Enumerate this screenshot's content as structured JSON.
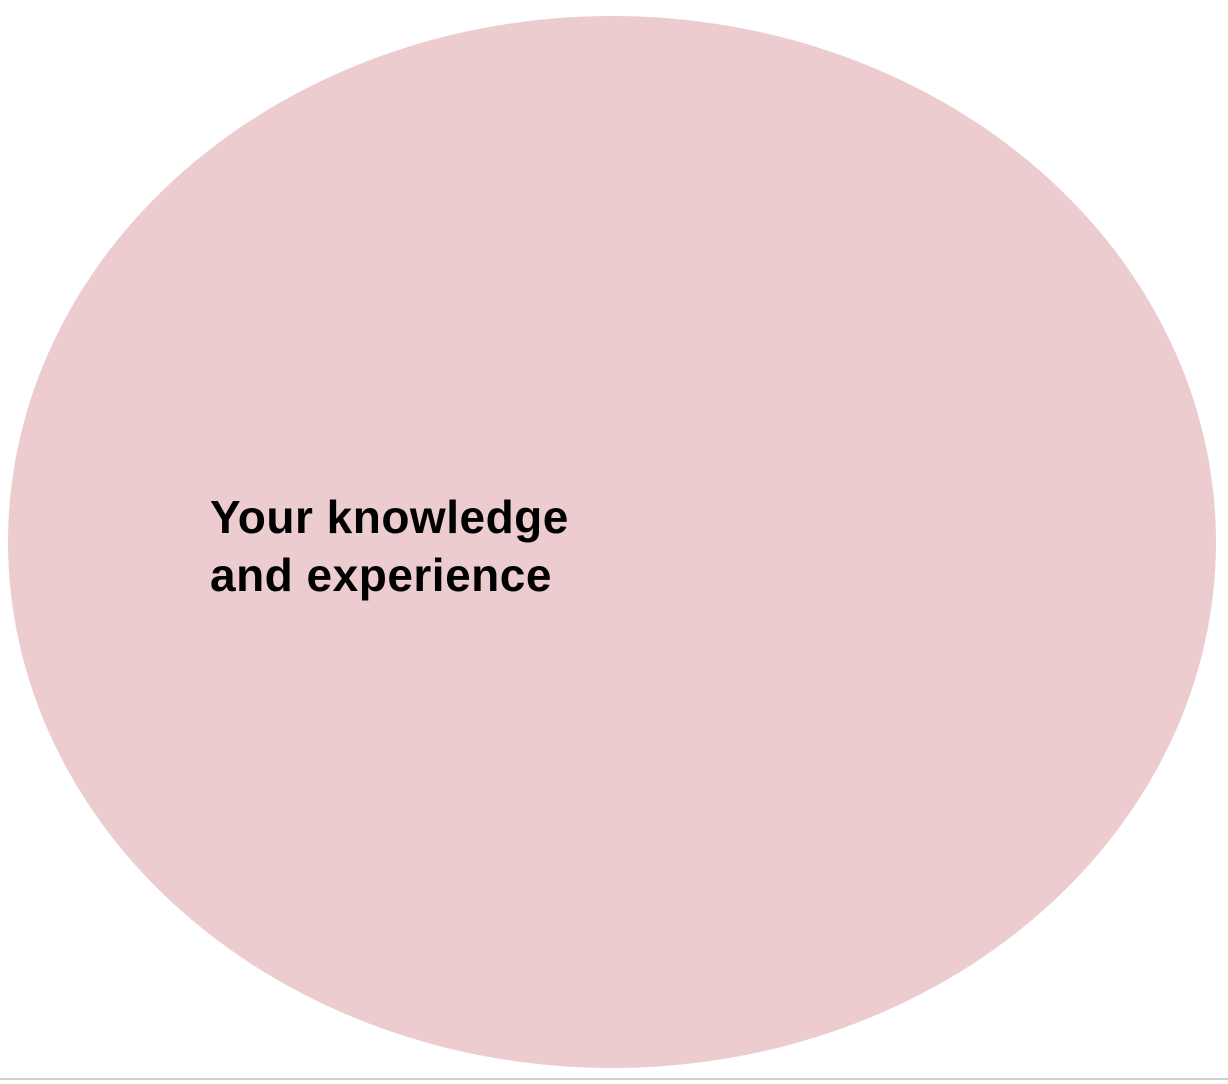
{
  "diagram": {
    "circle": {
      "label_line_1": "Your knowledge",
      "label_line_2": "and experience",
      "fill_color": "#ecccce"
    },
    "background_color": "#ffffff",
    "text_color": "#000000"
  }
}
